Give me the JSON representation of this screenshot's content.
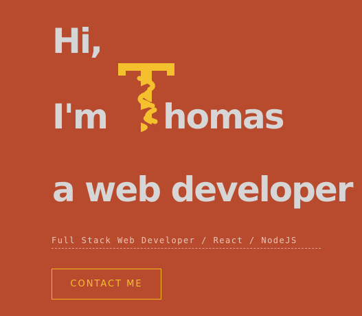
{
  "hero": {
    "greeting": "Hi,",
    "intro_prefix": "I'm",
    "name_rest": "homas",
    "tagline": "a web developer",
    "subtitle": "Full Stack Web Developer / React / NodeJS",
    "contact_label": "CONTACT ME"
  },
  "colors": {
    "background": "#b84a2d",
    "heading_text": "#d6d6d6",
    "accent": "#f5c02e",
    "subtitle_text": "#e8c6b8"
  },
  "logo": {
    "icon": "twisted-t-logo-icon"
  }
}
